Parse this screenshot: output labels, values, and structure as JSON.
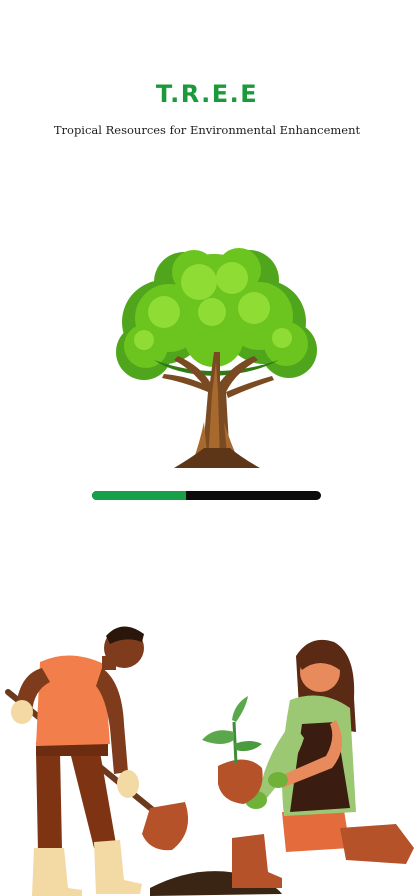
{
  "app": {
    "title": "T.R.E.E",
    "subtitle": "Tropical Resources for Environmental Enhancement"
  },
  "loading": {
    "progress": 0.41
  },
  "colors": {
    "brand_green": "#1a9a3a",
    "progress_fill": "#17a04a",
    "progress_track": "#0b0b0b",
    "background": "#ffffff"
  },
  "illustrations": {
    "hero": "tree-illustration",
    "footer": "gardeners-planting-illustration"
  }
}
